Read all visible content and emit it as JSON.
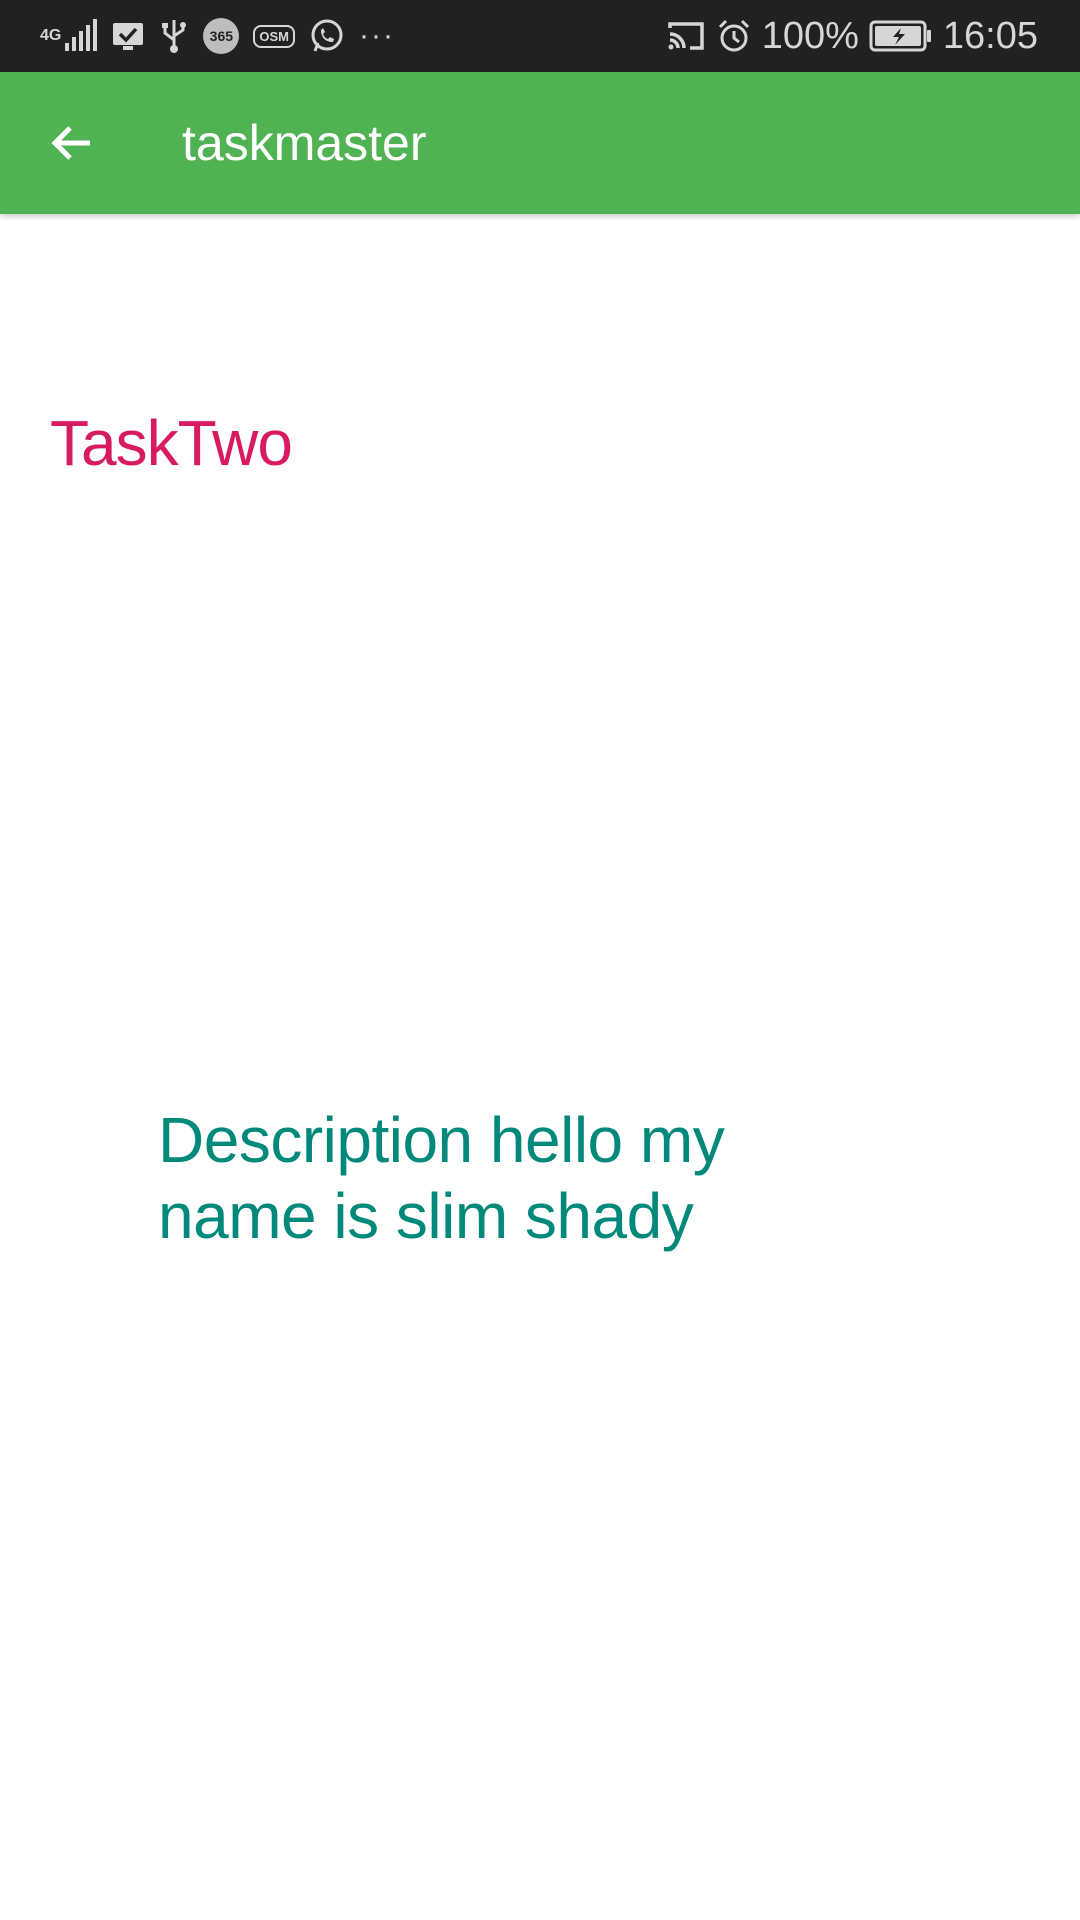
{
  "status_bar": {
    "network": "4G",
    "battery_percent": "100%",
    "time": "16:05",
    "badge_365": "365",
    "badge_osm": "OSM",
    "more_dots": "···",
    "left_icons": [
      "signal-icon",
      "checkbox-monitor-icon",
      "usb-icon",
      "365-app-icon",
      "osm-app-icon",
      "whatsapp-icon",
      "more-notifications-icon"
    ],
    "right_icons": [
      "cast-icon",
      "alarm-icon",
      "battery-charging-icon"
    ]
  },
  "app_bar": {
    "title": "taskmaster",
    "back_icon": "arrow-back-icon",
    "color": "#4fb253"
  },
  "task": {
    "title": "TaskTwo",
    "title_color": "#d81b60",
    "description": "Description hello my name is slim shady",
    "description_color": "#00897b"
  }
}
